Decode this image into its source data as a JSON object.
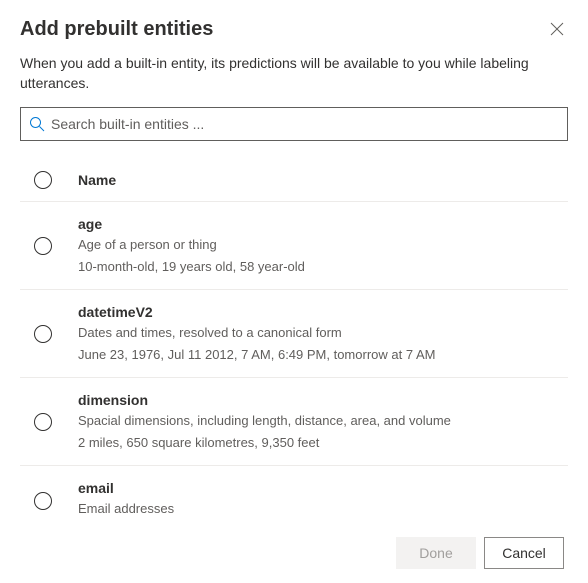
{
  "dialog": {
    "title": "Add prebuilt entities",
    "subtitle": "When you add a built-in entity, its predictions will be available to you while labeling utterances."
  },
  "search": {
    "placeholder": "Search built-in entities ..."
  },
  "table": {
    "header": "Name"
  },
  "entities": [
    {
      "name": "age",
      "description": "Age of a person or thing",
      "examples": "10-month-old, 19 years old, 58 year-old"
    },
    {
      "name": "datetimeV2",
      "description": "Dates and times, resolved to a canonical form",
      "examples": "June 23, 1976, Jul 11 2012, 7 AM, 6:49 PM, tomorrow at 7 AM"
    },
    {
      "name": "dimension",
      "description": "Spacial dimensions, including length, distance, area, and volume",
      "examples": "2 miles, 650 square kilometres, 9,350 feet"
    },
    {
      "name": "email",
      "description": "Email addresses",
      "examples": ""
    }
  ],
  "footer": {
    "done": "Done",
    "cancel": "Cancel"
  }
}
